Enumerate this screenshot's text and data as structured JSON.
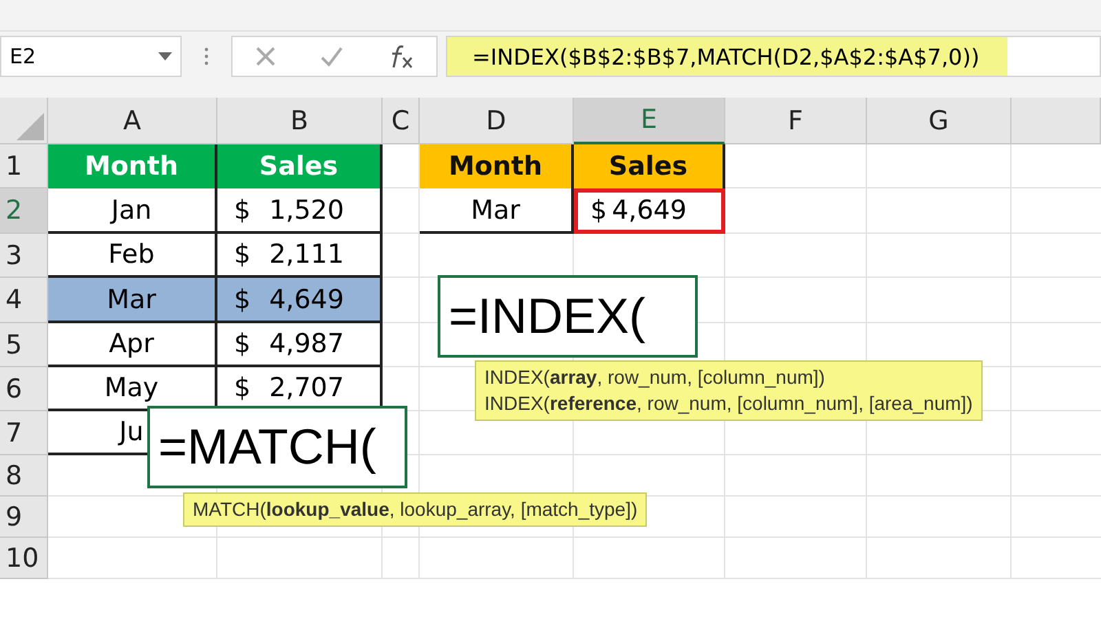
{
  "name_box": {
    "value": "E2"
  },
  "formula_bar": {
    "formula": "=INDEX($B$2:$B$7,MATCH(D2,$A$2:$A$7,0))"
  },
  "columns": [
    {
      "label": "A",
      "selected": false
    },
    {
      "label": "B",
      "selected": false
    },
    {
      "label": "C",
      "selected": false
    },
    {
      "label": "D",
      "selected": false
    },
    {
      "label": "E",
      "selected": true
    },
    {
      "label": "F",
      "selected": false
    },
    {
      "label": "G",
      "selected": false
    }
  ],
  "rows": [
    {
      "label": "1",
      "selected": false,
      "cells": [
        {
          "kind": "header",
          "text": "Month",
          "color": "#00b050"
        },
        {
          "kind": "header",
          "text": "Sales",
          "color": "#00b050"
        },
        {
          "kind": "empty"
        },
        {
          "kind": "header",
          "text": "Month",
          "color": "#ffc000"
        },
        {
          "kind": "header",
          "text": "Sales",
          "color": "#ffc000"
        }
      ]
    },
    {
      "label": "2",
      "selected": true,
      "cells": [
        {
          "kind": "text",
          "text": "Jan",
          "selected": false,
          "highlighted": false
        },
        {
          "kind": "currency",
          "symbol": "$",
          "amount": "1,520",
          "selected": false,
          "highlighted": false
        },
        {
          "kind": "empty"
        },
        {
          "kind": "text",
          "text": "Mar",
          "selected": false,
          "highlighted": false
        },
        {
          "kind": "currency",
          "symbol": "$",
          "amount": "4,649",
          "selected": true,
          "highlighted": false
        }
      ]
    },
    {
      "label": "3",
      "selected": false,
      "cells": [
        {
          "kind": "text",
          "text": "Feb",
          "selected": false,
          "highlighted": false
        },
        {
          "kind": "currency",
          "symbol": "$",
          "amount": "2,111",
          "selected": false,
          "highlighted": false
        },
        {
          "kind": "empty"
        },
        {
          "kind": "empty"
        },
        {
          "kind": "empty"
        }
      ]
    },
    {
      "label": "4",
      "selected": false,
      "cells": [
        {
          "kind": "text",
          "text": "Mar",
          "selected": false,
          "highlighted": true
        },
        {
          "kind": "currency",
          "symbol": "$",
          "amount": "4,649",
          "selected": false,
          "highlighted": true
        },
        {
          "kind": "empty"
        },
        {
          "kind": "empty"
        },
        {
          "kind": "empty"
        }
      ]
    },
    {
      "label": "5",
      "selected": false,
      "cells": [
        {
          "kind": "text",
          "text": "Apr",
          "selected": false,
          "highlighted": false
        },
        {
          "kind": "currency",
          "symbol": "$",
          "amount": "4,987",
          "selected": false,
          "highlighted": false
        },
        {
          "kind": "empty"
        },
        {
          "kind": "empty"
        },
        {
          "kind": "empty"
        }
      ]
    },
    {
      "label": "6",
      "selected": false,
      "cells": [
        {
          "kind": "text",
          "text": "May",
          "selected": false,
          "highlighted": false
        },
        {
          "kind": "currency",
          "symbol": "$",
          "amount": "2,707",
          "selected": false,
          "highlighted": false
        },
        {
          "kind": "empty"
        },
        {
          "kind": "empty"
        },
        {
          "kind": "empty"
        }
      ]
    },
    {
      "label": "7",
      "selected": false,
      "cells": [
        {
          "kind": "text",
          "text": "Ju",
          "selected": false,
          "highlighted": false
        },
        {
          "kind": "empty"
        },
        {
          "kind": "empty"
        },
        {
          "kind": "empty"
        },
        {
          "kind": "empty"
        }
      ]
    },
    {
      "label": "8",
      "selected": false,
      "cells": [
        {
          "kind": "empty"
        },
        {
          "kind": "empty"
        },
        {
          "kind": "empty"
        },
        {
          "kind": "empty"
        },
        {
          "kind": "empty"
        }
      ]
    },
    {
      "label": "9",
      "selected": false,
      "cells": [
        {
          "kind": "empty"
        },
        {
          "kind": "empty"
        },
        {
          "kind": "empty"
        },
        {
          "kind": "empty"
        },
        {
          "kind": "empty"
        }
      ]
    },
    {
      "label": "10",
      "selected": false,
      "cells": [
        {
          "kind": "empty"
        },
        {
          "kind": "empty"
        },
        {
          "kind": "empty"
        },
        {
          "kind": "empty"
        },
        {
          "kind": "empty"
        }
      ]
    }
  ],
  "editors": [
    {
      "formula": "=INDEX(",
      "tooltip": [
        "INDEX(**array**, row_num, [column_num])",
        "INDEX(**reference**, row_num, [column_num], [area_num])"
      ]
    },
    {
      "formula": "=MATCH(",
      "tooltip": [
        "MATCH(**lookup_value**, lookup_array, [match_type])"
      ]
    }
  ]
}
